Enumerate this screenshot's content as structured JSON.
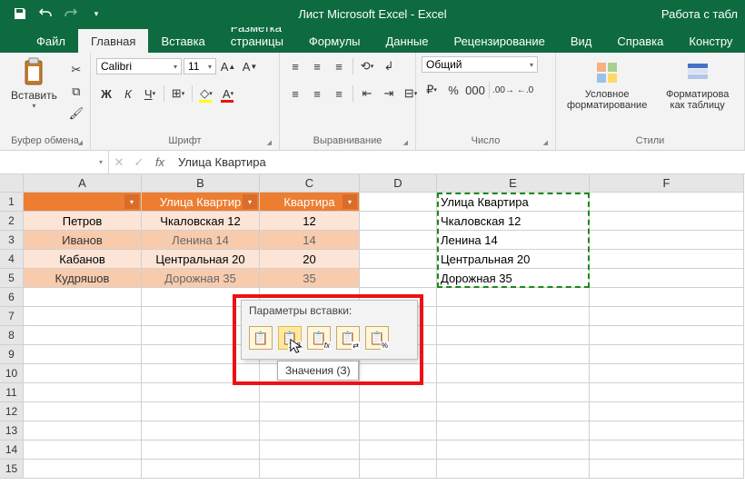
{
  "title": "Лист Microsoft Excel  -  Excel",
  "titleRight": "Работа с табл",
  "tabs": {
    "file": "Файл",
    "home": "Главная",
    "insert": "Вставка",
    "layout": "Разметка страницы",
    "formulas": "Формулы",
    "data": "Данные",
    "review": "Рецензирование",
    "view": "Вид",
    "help": "Справка",
    "design": "Констру"
  },
  "ribbon": {
    "clipboard": {
      "paste": "Вставить",
      "label": "Буфер обмена"
    },
    "font": {
      "name": "Calibri",
      "size": "11",
      "label": "Шрифт"
    },
    "alignment": {
      "label": "Выравнивание"
    },
    "number": {
      "format": "Общий",
      "label": "Число"
    },
    "styles": {
      "condfmt": "Условное форматирование",
      "tablefmt": "Форматирова как таблицу",
      "label": "Стили"
    }
  },
  "formulaBar": {
    "nameBox": "",
    "formula": "Улица Квартира"
  },
  "columns": [
    "A",
    "B",
    "C",
    "D",
    "E",
    "F"
  ],
  "tableHeaders": {
    "a": "",
    "b": "Улица Квартир",
    "c": "Квартира"
  },
  "rows": [
    {
      "a": "Петров",
      "b": "Чкаловская 12",
      "c": "12"
    },
    {
      "a": "Иванов",
      "b": "Ленина 14",
      "c": "14"
    },
    {
      "a": "Кабанов",
      "b": "Центральная 20",
      "c": "20"
    },
    {
      "a": "Кудряшов",
      "b": "Дорожная 35",
      "c": "35"
    }
  ],
  "pasted": [
    "Улица Квартира",
    "Чкаловская 12",
    "Ленина 14",
    "Центральная 20",
    "Дорожная 35"
  ],
  "popup": {
    "title": "Параметры вставки:",
    "tooltip": "Значения (З)"
  }
}
